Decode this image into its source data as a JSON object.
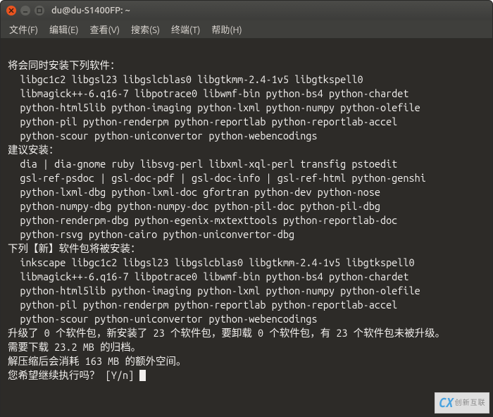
{
  "titlebar": {
    "title": "du@du-S1400FP: ~"
  },
  "menubar": {
    "file": "文件(F)",
    "edit": "编辑(E)",
    "view": "查看(V)",
    "search": "搜索(S)",
    "terminal": "终端(T)",
    "help": "帮助(H)"
  },
  "output": {
    "section1_header": "将会同时安装下列软件：",
    "section1_lines": [
      "libgc1c2 libgsl23 libgslcblas0 libgtkmm-2.4-1v5 libgtkspell0",
      "libmagick++-6.q16-7 libpotrace0 libwmf-bin python-bs4 python-chardet",
      "python-html5lib python-imaging python-lxml python-numpy python-olefile",
      "python-pil python-renderpm python-reportlab python-reportlab-accel",
      "python-scour python-uniconvertor python-webencodings"
    ],
    "section2_header": "建议安装：",
    "section2_lines": [
      "dia | dia-gnome ruby libsvg-perl libxml-xql-perl transfig pstoedit",
      "gsl-ref-psdoc | gsl-doc-pdf | gsl-doc-info | gsl-ref-html python-genshi",
      "python-lxml-dbg python-lxml-doc gfortran python-dev python-nose",
      "python-numpy-dbg python-numpy-doc python-pil-doc python-pil-dbg",
      "python-renderpm-dbg python-egenix-mxtexttools python-reportlab-doc",
      "python-rsvg python-cairo python-uniconvertor-dbg"
    ],
    "section3_header": "下列【新】软件包将被安装：",
    "section3_lines": [
      "inkscape libgc1c2 libgsl23 libgslcblas0 libgtkmm-2.4-1v5 libgtkspell0",
      "libmagick++-6.q16-7 libpotrace0 libwmf-bin python-bs4 python-chardet",
      "python-html5lib python-imaging python-lxml python-numpy python-olefile",
      "python-pil python-renderpm python-reportlab python-reportlab-accel",
      "python-scour python-uniconvertor python-webencodings"
    ],
    "summary1": "升级了 0 个软件包，新安装了 23 个软件包，要卸载 0 个软件包，有 23 个软件包未被升级。",
    "summary2": "需要下载 23.2 MB 的归档。",
    "summary3": "解压缩后会消耗 163 MB 的额外空间。",
    "prompt": "您希望继续执行吗？ [Y/n] "
  },
  "watermark": {
    "logo": "CX",
    "text": "创新互联"
  }
}
